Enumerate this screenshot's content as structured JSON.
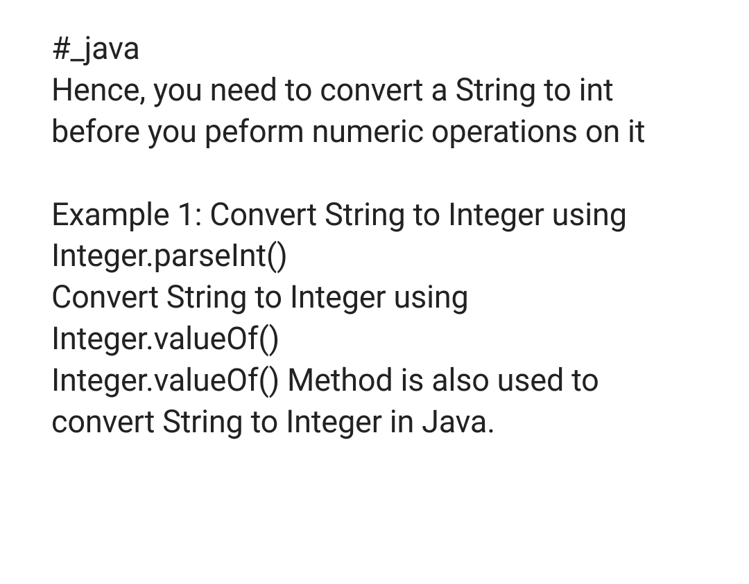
{
  "lines": {
    "tag": "#_java",
    "p1a": "Hence, you need to convert a String to int",
    "p1b": "before you peform numeric operations on it",
    "ex1a": "Example 1: Convert String to Integer using",
    "ex1b": "Integer.parseInt()",
    "p2a": "Convert String to Integer using",
    "p2b": "Integer.valueOf()",
    "p3a": "Integer.valueOf() Method is also used to",
    "p3b": "convert String to Integer in Java."
  }
}
